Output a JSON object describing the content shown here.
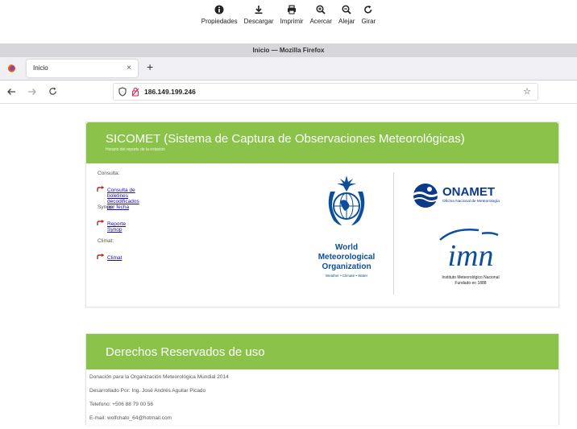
{
  "viewer_toolbar": {
    "items": [
      {
        "label": "Propiedades",
        "icon": "info-icon"
      },
      {
        "label": "Descargar",
        "icon": "download-icon"
      },
      {
        "label": "Imprimir",
        "icon": "print-icon"
      },
      {
        "label": "Acercar",
        "icon": "zoom-in-icon"
      },
      {
        "label": "Alejar",
        "icon": "zoom-out-icon"
      },
      {
        "label": "Girar",
        "icon": "rotate-icon"
      }
    ]
  },
  "browser": {
    "window_title": "Inicio — Mozilla Firefox",
    "tab_label": "Inicio",
    "tab_close": "×",
    "new_tab": "+",
    "url": "186.149.199.246"
  },
  "header": {
    "title": "SICOMET (Sistema de Captura de Observaciones Meteorológicas)",
    "subtitle": "Horario del reporte de la estación"
  },
  "links": {
    "consulta_label": "Consulta:",
    "consulta_link": "Consulta de boletines decodificados por fecha",
    "synop_label": "Synop:",
    "synop_link": "Reporte Synop",
    "climat_label": "Climat:",
    "climat_link": "Climat"
  },
  "wmo": {
    "line1": "World",
    "line2": "Meteorological",
    "line3": "Organization",
    "tagline": "Weather • Climate • Water"
  },
  "onamet": {
    "name": "ONAMET",
    "sub": "Oficina Nacional de Meteorología"
  },
  "imn": {
    "wordmark": "imn",
    "line1": "Instituto Meteorológico Nacional",
    "line2": "Fundado en 1888"
  },
  "footer": {
    "title": "Derechos Reservados de uso",
    "lines": [
      "Donación para la Organización Meteorológica Mundial 2014",
      "Desarrollado Por: Ing. José Andrés Aguilar Picado",
      "Telefono: +506 88 79 00 56",
      "E-mail: wolfchato_64@hotmail.com"
    ]
  },
  "colors": {
    "header_green": "#8bc34a",
    "link_blue": "#1a0dab",
    "wmo_blue": "#0b4f9c",
    "onamet_blue": "#0b3a8c"
  }
}
